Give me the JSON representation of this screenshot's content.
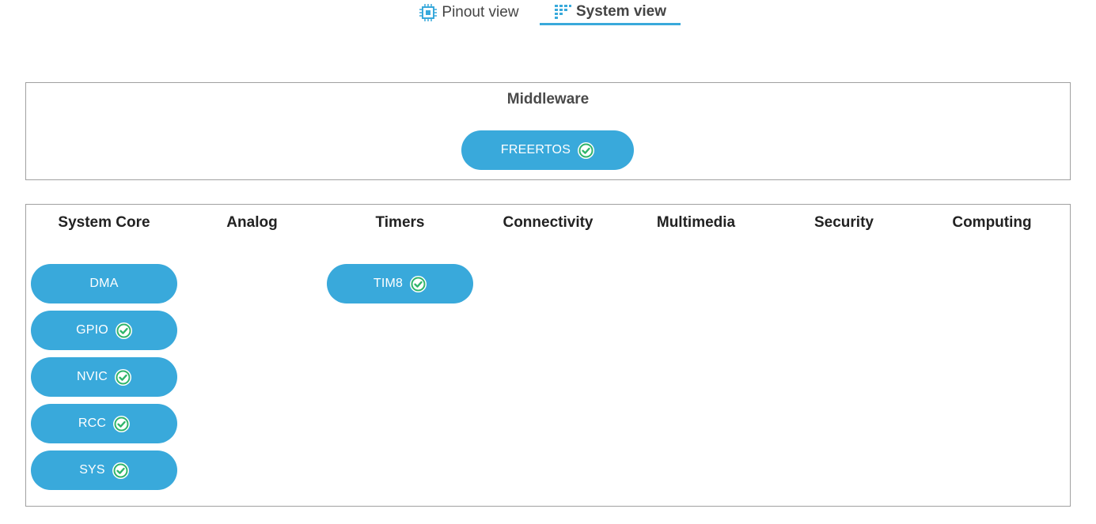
{
  "tabs": [
    {
      "label": "Pinout view",
      "icon": "chip-icon",
      "active": false
    },
    {
      "label": "System view",
      "icon": "system-view-icon",
      "active": true
    }
  ],
  "middleware": {
    "title": "Middleware",
    "items": [
      {
        "label": "FREERTOS",
        "configured": true
      }
    ]
  },
  "categories": [
    {
      "title": "System Core",
      "items": [
        {
          "label": "DMA",
          "configured": false
        },
        {
          "label": "GPIO",
          "configured": true
        },
        {
          "label": "NVIC",
          "configured": true
        },
        {
          "label": "RCC",
          "configured": true
        },
        {
          "label": "SYS",
          "configured": true
        }
      ]
    },
    {
      "title": "Analog",
      "items": []
    },
    {
      "title": "Timers",
      "items": [
        {
          "label": "TIM8",
          "configured": true
        }
      ]
    },
    {
      "title": "Connectivity",
      "items": []
    },
    {
      "title": "Multimedia",
      "items": []
    },
    {
      "title": "Security",
      "items": []
    },
    {
      "title": "Computing",
      "items": []
    }
  ],
  "colors": {
    "accent": "#39a9db",
    "check": "#2fb56a",
    "border": "#a0a0a0"
  }
}
